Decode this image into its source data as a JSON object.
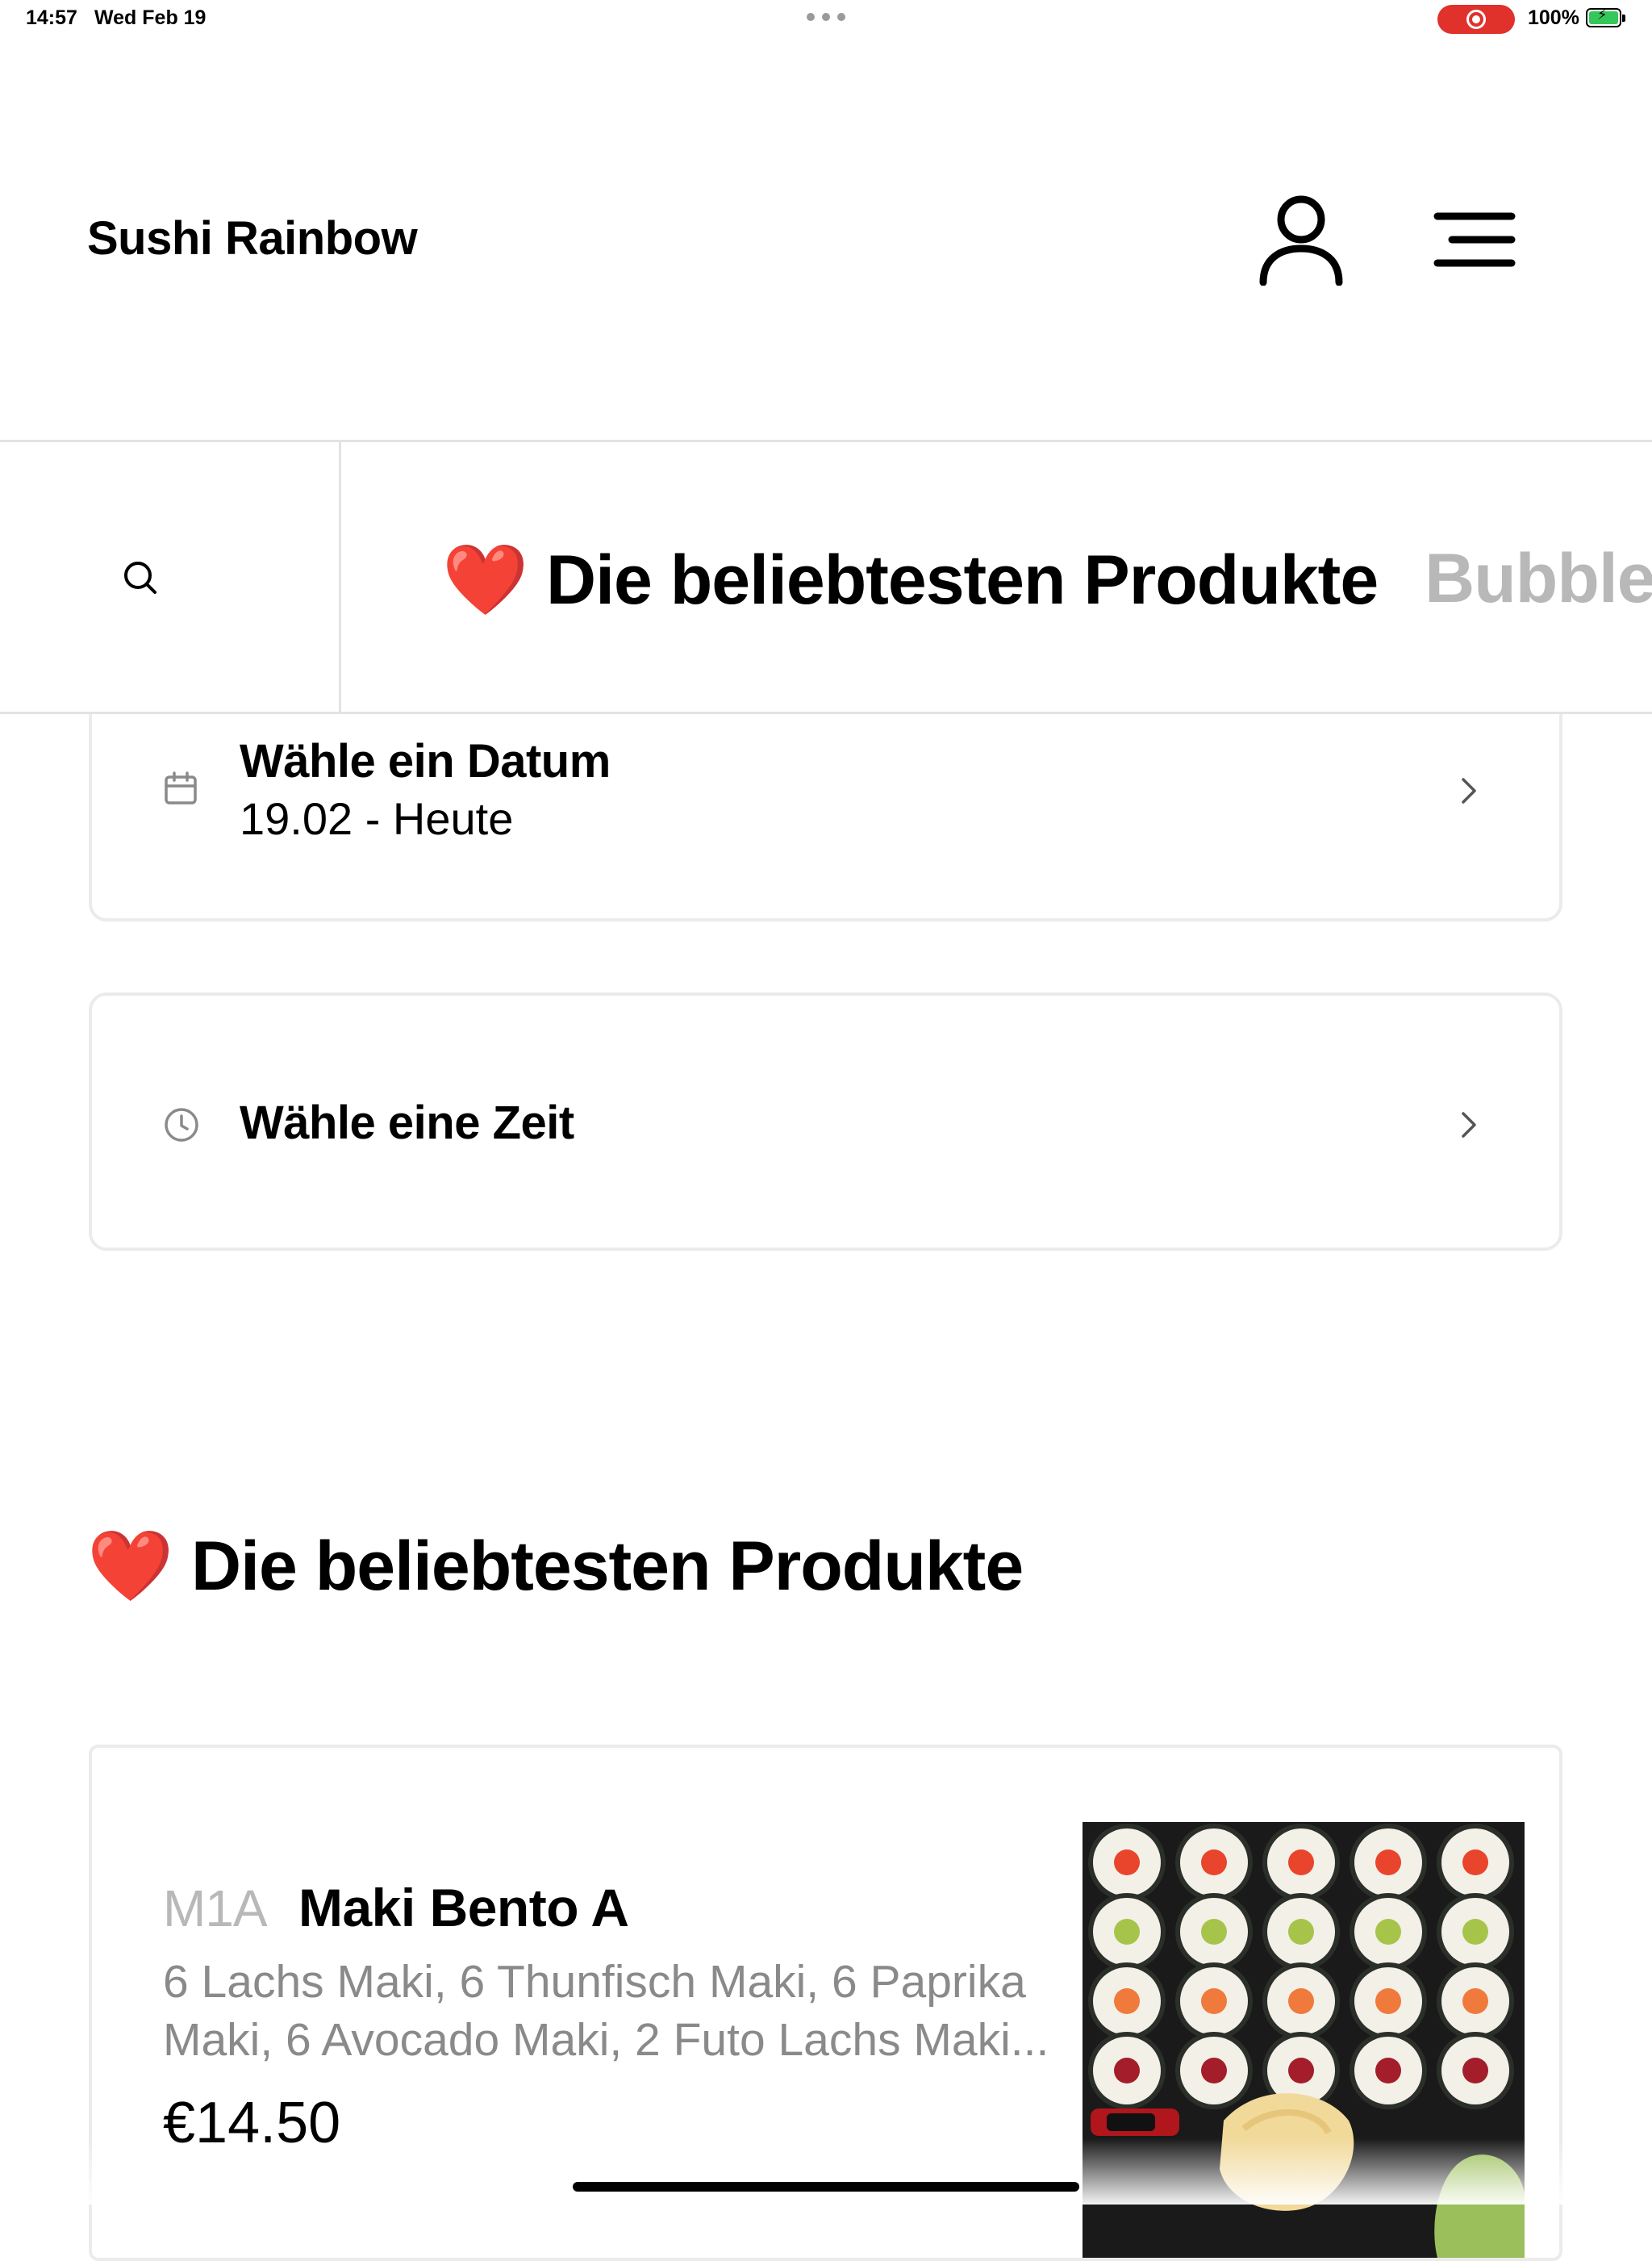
{
  "status_bar": {
    "time": "14:57",
    "date": "Wed Feb 19",
    "battery": "100%"
  },
  "header": {
    "title": "Sushi Rainbow",
    "user_icon": "user-icon",
    "menu_icon": "hamburger-menu-icon"
  },
  "categories": {
    "search_icon": "search-icon",
    "tabs": [
      {
        "emoji": "❤️",
        "label": "Die beliebtesten Produkte",
        "active": true
      },
      {
        "emoji": "",
        "label": "Bubble",
        "active": false
      }
    ]
  },
  "date_picker": {
    "icon": "calendar-icon",
    "title": "Wähle ein Datum",
    "value": "19.02 - Heute"
  },
  "time_picker": {
    "icon": "clock-icon",
    "title": "Wähle eine Zeit"
  },
  "section": {
    "emoji": "❤️",
    "title": "Die beliebtesten Produkte"
  },
  "products": [
    {
      "code": "M1A",
      "name": "Maki Bento A",
      "description": "6 Lachs Maki, 6 Thunfisch Maki, 6 Paprika Maki, 6 Avocado Maki, 2 Futo Lachs Maki...",
      "price": "€14.50"
    }
  ],
  "colors": {
    "accent_red": "#e0211e",
    "border": "#ebebeb",
    "muted_text": "#8a8a8a",
    "inactive_tab": "#b8b8b8"
  }
}
